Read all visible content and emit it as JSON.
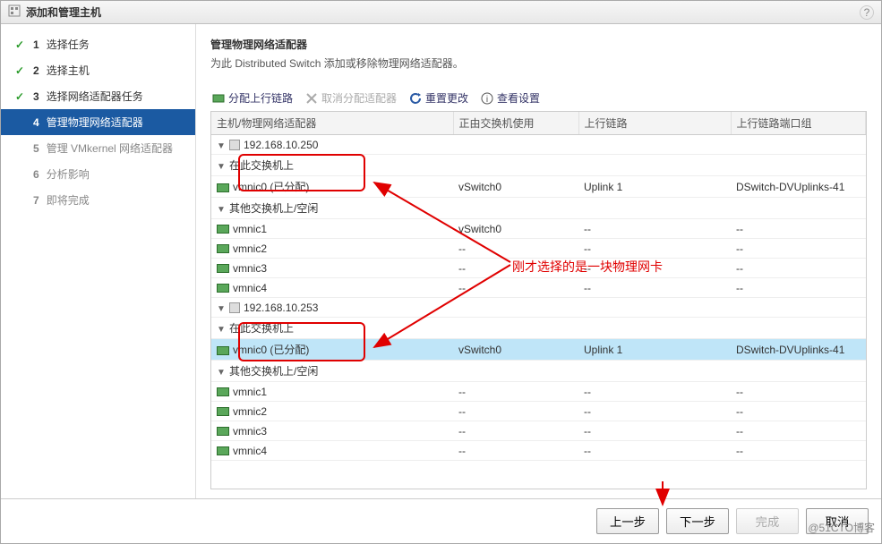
{
  "dialog": {
    "title": "添加和管理主机"
  },
  "steps": [
    {
      "num": "1",
      "label": "选择任务",
      "state": "done"
    },
    {
      "num": "2",
      "label": "选择主机",
      "state": "done"
    },
    {
      "num": "3",
      "label": "选择网络适配器任务",
      "state": "done"
    },
    {
      "num": "4",
      "label": "管理物理网络适配器",
      "state": "active"
    },
    {
      "num": "5",
      "label": "管理 VMkernel 网络适配器",
      "state": "pending"
    },
    {
      "num": "6",
      "label": "分析影响",
      "state": "pending"
    },
    {
      "num": "7",
      "label": "即将完成",
      "state": "pending"
    }
  ],
  "main": {
    "title": "管理物理网络适配器",
    "desc": "为此 Distributed Switch 添加或移除物理网络适配器。"
  },
  "toolbar": {
    "assign": "分配上行链路",
    "unassign": "取消分配适配器",
    "reset": "重置更改",
    "view": "查看设置"
  },
  "columns": {
    "host": "主机/物理网络适配器",
    "usedby": "正由交换机使用",
    "uplink": "上行链路",
    "portgroup": "上行链路端口组"
  },
  "rows": [
    {
      "type": "host",
      "indent": 0,
      "label": "192.168.10.250",
      "usedby": "",
      "uplink": "",
      "pg": ""
    },
    {
      "type": "group",
      "indent": 1,
      "label": "在此交换机上",
      "usedby": "",
      "uplink": "",
      "pg": ""
    },
    {
      "type": "nic",
      "indent": 2,
      "label": "vmnic0 (已分配)",
      "usedby": "vSwitch0",
      "uplink": "Uplink 1",
      "pg": "DSwitch-DVUplinks-41",
      "boxed": true
    },
    {
      "type": "group",
      "indent": 1,
      "label": "其他交换机上/空闲",
      "usedby": "",
      "uplink": "",
      "pg": ""
    },
    {
      "type": "nic",
      "indent": 2,
      "label": "vmnic1",
      "usedby": "vSwitch0",
      "uplink": "--",
      "pg": "--"
    },
    {
      "type": "nic",
      "indent": 2,
      "label": "vmnic2",
      "usedby": "--",
      "uplink": "--",
      "pg": "--"
    },
    {
      "type": "nic",
      "indent": 2,
      "label": "vmnic3",
      "usedby": "--",
      "uplink": "--",
      "pg": "--"
    },
    {
      "type": "nic",
      "indent": 2,
      "label": "vmnic4",
      "usedby": "--",
      "uplink": "--",
      "pg": "--"
    },
    {
      "type": "host",
      "indent": 0,
      "label": "192.168.10.253",
      "usedby": "",
      "uplink": "",
      "pg": ""
    },
    {
      "type": "group",
      "indent": 1,
      "label": "在此交换机上",
      "usedby": "",
      "uplink": "",
      "pg": ""
    },
    {
      "type": "nic",
      "indent": 2,
      "label": "vmnic0 (已分配)",
      "usedby": "vSwitch0",
      "uplink": "Uplink 1",
      "pg": "DSwitch-DVUplinks-41",
      "boxed": true,
      "selected": true
    },
    {
      "type": "group",
      "indent": 1,
      "label": "其他交换机上/空闲",
      "usedby": "",
      "uplink": "",
      "pg": ""
    },
    {
      "type": "nic",
      "indent": 2,
      "label": "vmnic1",
      "usedby": "--",
      "uplink": "--",
      "pg": "--"
    },
    {
      "type": "nic",
      "indent": 2,
      "label": "vmnic2",
      "usedby": "--",
      "uplink": "--",
      "pg": "--"
    },
    {
      "type": "nic",
      "indent": 2,
      "label": "vmnic3",
      "usedby": "--",
      "uplink": "--",
      "pg": "--"
    },
    {
      "type": "nic",
      "indent": 2,
      "label": "vmnic4",
      "usedby": "--",
      "uplink": "--",
      "pg": "--"
    }
  ],
  "annotation": {
    "text": "刚才选择的是一块物理网卡"
  },
  "footer": {
    "back": "上一步",
    "next": "下一步",
    "finish": "完成",
    "cancel": "取消"
  },
  "watermark": "@51CTO博客"
}
